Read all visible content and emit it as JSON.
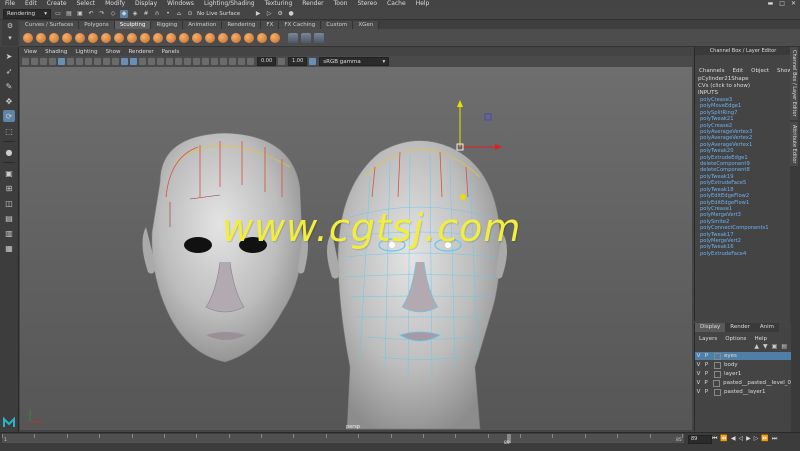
{
  "menubar": {
    "items": [
      "File",
      "Edit",
      "Create",
      "Select",
      "Modify",
      "Display",
      "Windows",
      "Lighting/Shading",
      "Texturing",
      "Render",
      "Toon",
      "Stereo",
      "Cache",
      "Help"
    ]
  },
  "statusline": {
    "mode": "Rendering",
    "live_surface": "No Live Surface"
  },
  "shelf": {
    "tabs": [
      "Curves / Surfaces",
      "Polygons",
      "Sculpting",
      "Rigging",
      "Animation",
      "Rendering",
      "FX",
      "FX Caching",
      "Custom",
      "XGen"
    ],
    "active_tab": "Sculpting"
  },
  "panel": {
    "menu": [
      "View",
      "Shading",
      "Lighting",
      "Show",
      "Renderer",
      "Panels"
    ],
    "field1": "0.00",
    "field2": "1.00",
    "color_space": "sRGB gamma",
    "camera": "persp"
  },
  "viewport": {
    "watermark": "www.cgtsj.com"
  },
  "channelbox": {
    "title": "Channel Box / Layer Editor",
    "menu": [
      "Channels",
      "Edit",
      "Object",
      "Show"
    ],
    "object": "pCylinder21Shape",
    "cvs": "CVs (click to show)",
    "inputs_label": "INPUTS",
    "history": [
      "polyCrease3",
      "polyMoveEdge1",
      "polySplitRing7",
      "polyTweak21",
      "polyCrease2",
      "polyAverageVertex3",
      "polyAverageVertex2",
      "polyAverageVertex1",
      "polyTweak20",
      "polyExtrudeEdge1",
      "deleteComponent9",
      "deleteComponent8",
      "polyTweak19",
      "polyExtrudeFace5",
      "polyTweak18",
      "polyEditEdgeFlow2",
      "polyEditEdgeFlow1",
      "polyCrease1",
      "polyMergeVert3",
      "polySmite2",
      "polyConnectComponents1",
      "polyTweak17",
      "polyMergeVert2",
      "polyTweak16",
      "polyExtrudeFace4"
    ]
  },
  "sidetabs": [
    "Channel Box / Layer Editor",
    "Attribute Editor"
  ],
  "layereditor": {
    "tabs": [
      "Display",
      "Render",
      "Anim"
    ],
    "menu": [
      "Layers",
      "Options",
      "Help"
    ],
    "layers": [
      {
        "v": "V",
        "p": "P",
        "name": "eyes",
        "selected": true
      },
      {
        "v": "V",
        "p": "P",
        "name": "body",
        "selected": false
      },
      {
        "v": "V",
        "p": "P",
        "name": "layer1",
        "selected": false
      },
      {
        "v": "V",
        "p": "P",
        "name": "pasted__pasted__level_0",
        "selected": false
      },
      {
        "v": "V",
        "p": "P",
        "name": "pasted__layer1",
        "selected": false
      }
    ]
  },
  "timeslider": {
    "ticks": [
      "1",
      "",
      "",
      "",
      "",
      "",
      "",
      "",
      "",
      "",
      "",
      "",
      "",
      "",
      "",
      "",
      "",
      "",
      "",
      "",
      "",
      "85"
    ],
    "current_frame": "89",
    "frame_field": "89"
  },
  "colors": {
    "accent": "#5c84a8",
    "watermark": "#f2ee3a",
    "history_text": "#6fb1f0"
  }
}
